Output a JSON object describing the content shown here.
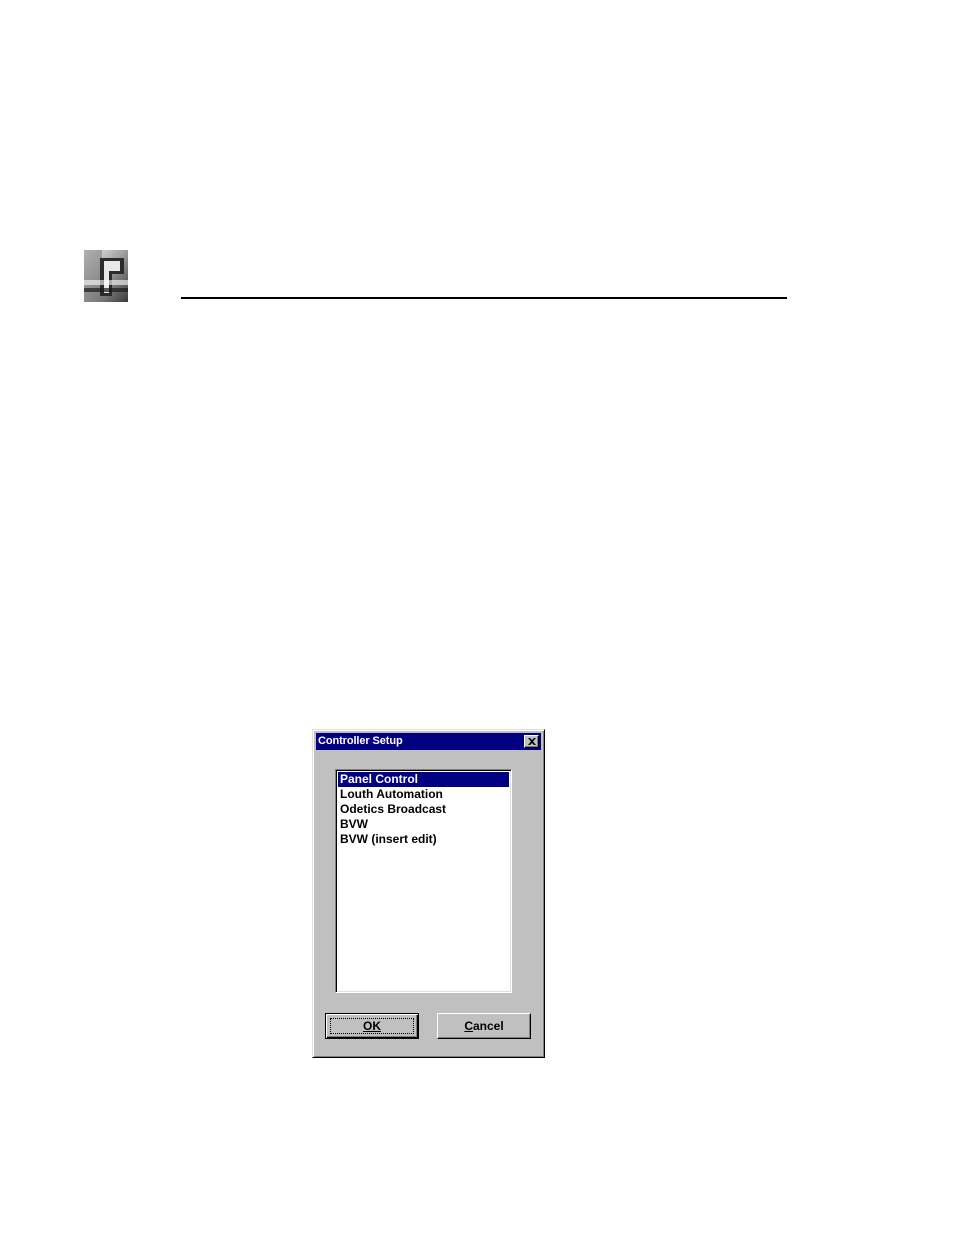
{
  "header": {
    "logo_icon": "pinnacle-p-logo"
  },
  "dialog": {
    "title": "Controller Setup",
    "close_icon": "close-x-icon",
    "list": {
      "items": [
        {
          "label": "Panel Control",
          "selected": true
        },
        {
          "label": "Louth Automation",
          "selected": false
        },
        {
          "label": "Odetics Broadcast",
          "selected": false
        },
        {
          "label": "BVW",
          "selected": false
        },
        {
          "label": "BVW (insert edit)",
          "selected": false
        }
      ]
    },
    "buttons": {
      "ok_label": "OK",
      "cancel_label": "Cancel"
    }
  },
  "colors": {
    "titlebar": "#000080",
    "selection": "#000080",
    "dialog_face": "#c0c0c0"
  }
}
